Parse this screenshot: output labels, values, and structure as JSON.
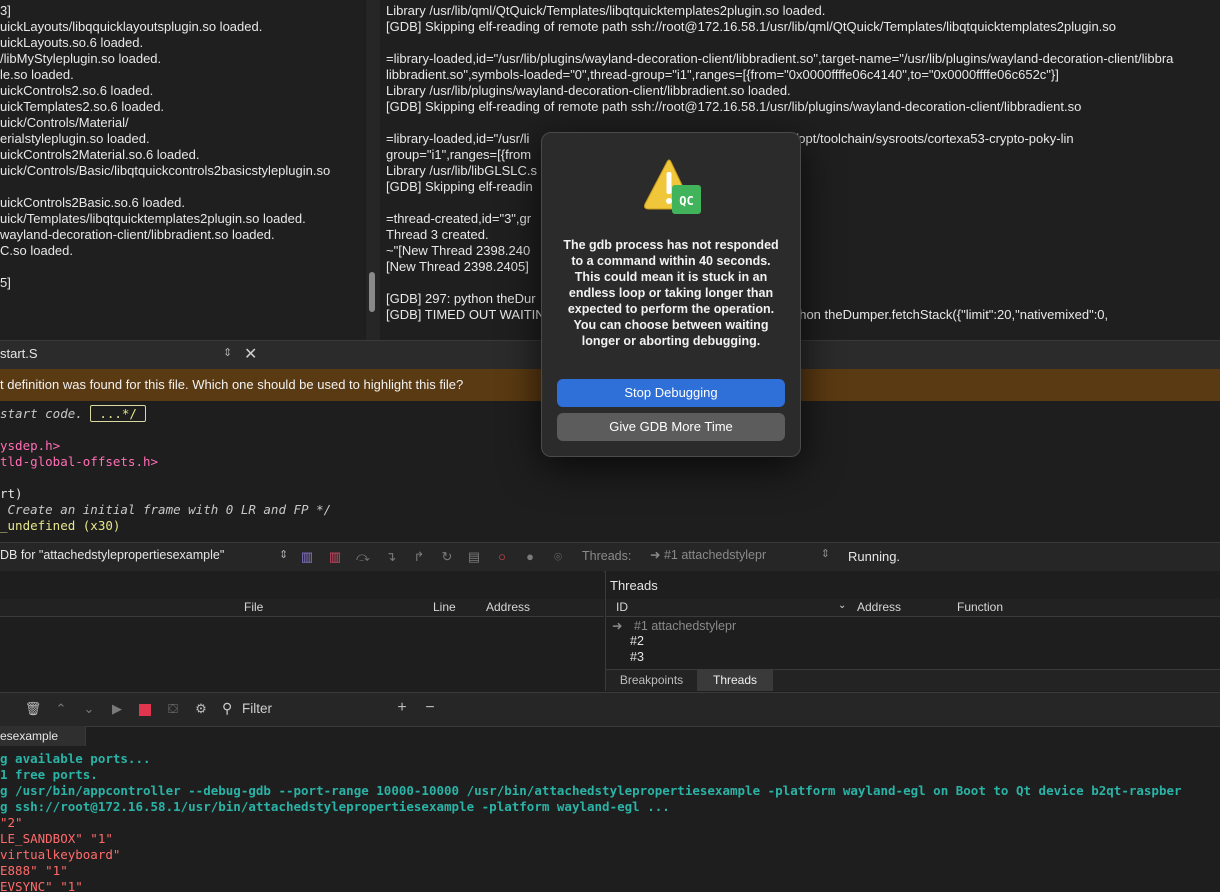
{
  "left_log": [
    "3]",
    "uickLayouts/libqquicklayoutsplugin.so loaded.",
    "uickLayouts.so.6 loaded.",
    "/libMyStyleplugin.so loaded.",
    "le.so loaded.",
    "uickControls2.so.6 loaded.",
    "uickTemplates2.so.6 loaded.",
    "uick/Controls/Material/",
    "erialstyleplugin.so loaded.",
    "uickControls2Material.so.6 loaded.",
    "uick/Controls/Basic/libqtquickcontrols2basicstyleplugin.so",
    "",
    "uickControls2Basic.so.6 loaded.",
    "uick/Templates/libqtquicktemplates2plugin.so loaded.",
    "wayland-decoration-client/libbradient.so loaded.",
    "C.so loaded.",
    "",
    "5]"
  ],
  "right_log": [
    "Library /usr/lib/qml/QtQuick/Templates/libqtquicktemplates2plugin.so loaded.",
    "[GDB] Skipping elf-reading of remote path ssh://root@172.16.58.1/usr/lib/qml/QtQuick/Templates/libqtquicktemplates2plugin.so",
    "",
    "=library-loaded,id=\"/usr/lib/plugins/wayland-decoration-client/libbradient.so\",target-name=\"/usr/lib/plugins/wayland-decoration-client/libbra",
    "libbradient.so\",symbols-loaded=\"0\",thread-group=\"i1\",ranges=[{from=\"0x0000ffffe06c4140\",to=\"0x0000ffffe06c652c\"}]",
    "Library /usr/lib/plugins/wayland-decoration-client/libbradient.so loaded.",
    "[GDB] Skipping elf-reading of remote path ssh://root@172.16.58.1/usr/lib/plugins/wayland-decoration-client/libbradient.so",
    "",
    "=library-loaded,id=\"/usr/li                                       SLC.so\",host-name=\"/opt/toolchain/sysroots/cortexa53-crypto-poky-lin",
    "group=\"i1\",ranges=[{from                                               97fa8\"}]",
    "Library /usr/lib/libGLSLC.s",
    "[GDB] Skipping elf-readin                                              /lib/libGLSLC.so",
    "",
    "=thread-created,id=\"3\",gr",
    "Thread 3 created.",
    "~\"[New Thread 2398.240",
    "[New Thread 2398.2405]",
    "",
    "[GDB] 297: python theDur                                                  \"token\":297})",
    "[GDB] TIMED OUT WAITIN                                          PROGRESS: \"python theDumper.fetchStack({\"limit\":20,\"nativemixed\":0,"
  ],
  "editor": {
    "file_name": "start.S",
    "info_message": "t definition was found for this file. Which one should be used to highlight this file?",
    "code": [
      {
        "text": "start code. ",
        "cls": "comment",
        "fold": "...*/"
      },
      {
        "text": "",
        "cls": "plain"
      },
      {
        "text": "ysdep.h>",
        "cls": "include"
      },
      {
        "text": "tld-global-offsets.h>",
        "cls": "include"
      },
      {
        "text": "",
        "cls": "plain"
      },
      {
        "text": "rt)",
        "cls": "plain"
      },
      {
        "text": " Create an initial frame with 0 LR and FP */",
        "cls": "comment"
      },
      {
        "text": "_undefined (x30)",
        "cls": "yellow"
      }
    ]
  },
  "debugger": {
    "session": "DB for \"attachedstylepropertiesexample\"",
    "threads_label": "Threads:",
    "thread_selected": "#1 attachedstylepr",
    "status": "Running.",
    "breakpoints_columns": [
      "File",
      "Line",
      "Address"
    ],
    "threads_title": "Threads",
    "threads_columns": [
      "ID",
      "Address",
      "Function"
    ],
    "threads": [
      {
        "id": "#1 attachedstylepr",
        "current": true
      },
      {
        "id": "#2",
        "current": false
      },
      {
        "id": "#3",
        "current": false
      }
    ],
    "tabs": [
      "Breakpoints",
      "Threads"
    ],
    "active_tab": "Threads"
  },
  "output": {
    "filter_placeholder": "Filter",
    "tab_label": "esexample",
    "lines": [
      {
        "text": "g available ports...",
        "cls": "teal"
      },
      {
        "text": "1 free ports.",
        "cls": "teal"
      },
      {
        "text": "g /usr/bin/appcontroller --debug-gdb --port-range 10000-10000 /usr/bin/attachedstylepropertiesexample -platform wayland-egl on Boot to Qt device b2qt-raspber",
        "cls": "teal"
      },
      {
        "text": "g ssh://root@172.16.58.1/usr/bin/attachedstylepropertiesexample -platform wayland-egl ...",
        "cls": "teal"
      },
      {
        "text": "\"2\"",
        "cls": "red"
      },
      {
        "text": "LE_SANDBOX\" \"1\"",
        "cls": "red"
      },
      {
        "text": "virtualkeyboard\"",
        "cls": "red"
      },
      {
        "text": "E888\" \"1\"",
        "cls": "red"
      },
      {
        "text": "EVSYNC\" \"1\"",
        "cls": "red"
      }
    ]
  },
  "dialog": {
    "icon_badge": "QC",
    "message_line1": "The gdb process has not responded to a command within 40 seconds. This could mean it is stuck in an endless loop or taking longer than expected to perform the operation.",
    "message_line2": "You can choose between waiting longer or aborting debugging.",
    "stop_button": "Stop Debugging",
    "more_time_button": "Give GDB More Time",
    "colors": {
      "primary": "#2f6fd8",
      "secondary": "#5c5c5c"
    }
  }
}
